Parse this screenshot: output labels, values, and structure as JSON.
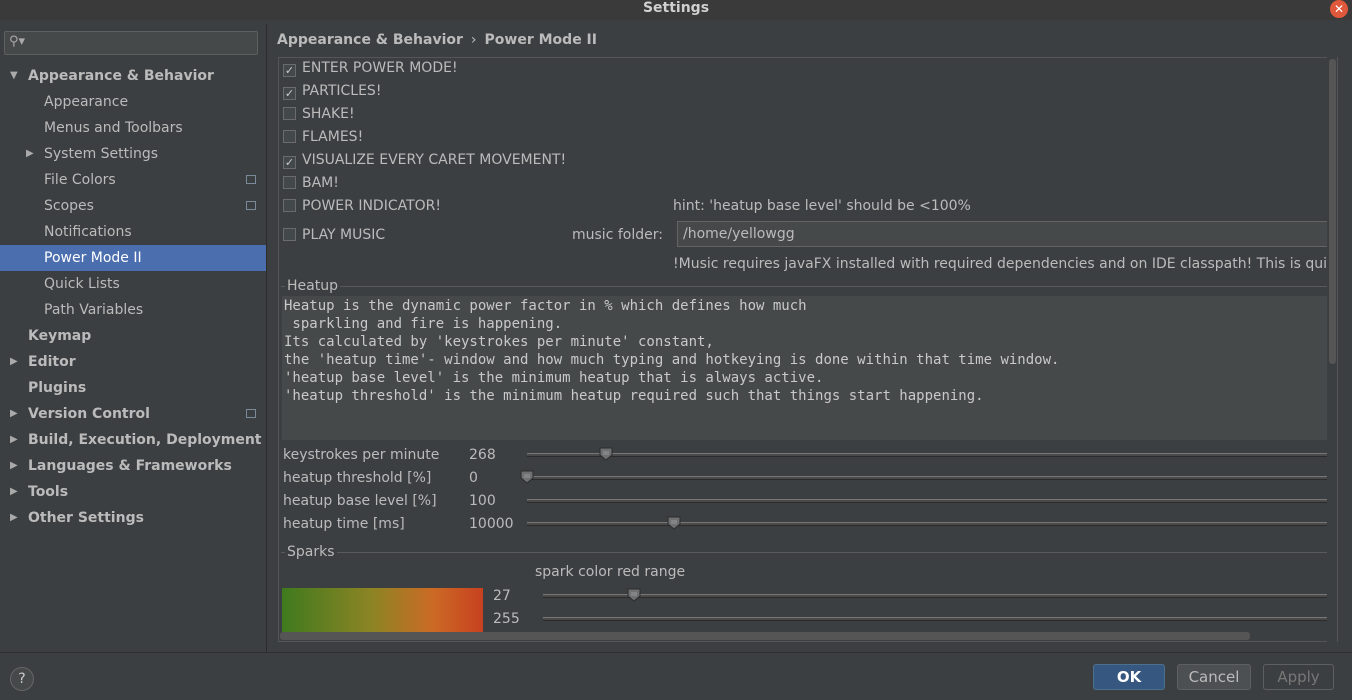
{
  "window": {
    "title": "Settings"
  },
  "breadcrumb": {
    "parent": "Appearance & Behavior",
    "separator": "›",
    "current": "Power Mode II"
  },
  "sidebar": {
    "items": [
      {
        "label": "Appearance & Behavior"
      },
      {
        "label": "Appearance"
      },
      {
        "label": "Menus and Toolbars"
      },
      {
        "label": "System Settings"
      },
      {
        "label": "File Colors"
      },
      {
        "label": "Scopes"
      },
      {
        "label": "Notifications"
      },
      {
        "label": "Power Mode II"
      },
      {
        "label": "Quick Lists"
      },
      {
        "label": "Path Variables"
      },
      {
        "label": "Keymap"
      },
      {
        "label": "Editor"
      },
      {
        "label": "Plugins"
      },
      {
        "label": "Version Control"
      },
      {
        "label": "Build, Execution, Deployment"
      },
      {
        "label": "Languages & Frameworks"
      },
      {
        "label": "Tools"
      },
      {
        "label": "Other Settings"
      }
    ]
  },
  "options": [
    {
      "label": "ENTER POWER MODE!",
      "checked": true
    },
    {
      "label": "PARTICLES!",
      "checked": true
    },
    {
      "label": "SHAKE!",
      "checked": false
    },
    {
      "label": "FLAMES!",
      "checked": false
    },
    {
      "label": "VISUALIZE EVERY CARET MOVEMENT!",
      "checked": true
    },
    {
      "label": "BAM!",
      "checked": false
    },
    {
      "label": "POWER INDICATOR!",
      "checked": false
    },
    {
      "label": "PLAY MUSIC",
      "checked": false
    }
  ],
  "hint": "hint: 'heatup base level' should be <100%",
  "music": {
    "label": "music folder:",
    "value": "/home/yellowgg",
    "warning": "!Music requires javaFX installed with required dependencies and on IDE classpath! This is quite ex"
  },
  "heatup": {
    "title": "Heatup",
    "description": "Heatup is the dynamic power factor in % which defines how much\n sparkling and fire is happening.\nIts calculated by 'keystrokes per minute' constant,\nthe 'heatup time'- window and how much typing and hotkeying is done within that time window.\n'heatup base level' is the minimum heatup that is always active.\n'heatup threshold' is the minimum heatup required such that things start happening.",
    "sliders": [
      {
        "label": "keystrokes per minute",
        "value": "268",
        "fraction": 0.097
      },
      {
        "label": "heatup threshold [%]",
        "value": "0",
        "fraction": 0.0
      },
      {
        "label": "heatup base level [%]",
        "value": "100",
        "fraction": null
      },
      {
        "label": "heatup time [ms]",
        "value": "10000",
        "fraction": 0.182
      }
    ]
  },
  "sparks": {
    "title": "Sparks",
    "range_label": "spark color red range",
    "sliders": [
      {
        "value": "27",
        "fraction": 0.115
      },
      {
        "value": "255",
        "fraction": null
      }
    ]
  },
  "buttons": {
    "help": "?",
    "ok": "OK",
    "cancel": "Cancel",
    "apply": "Apply"
  },
  "colors": {
    "selection": "#4b6eaf",
    "ok_button": "#365880",
    "background": "#3c3f41"
  }
}
